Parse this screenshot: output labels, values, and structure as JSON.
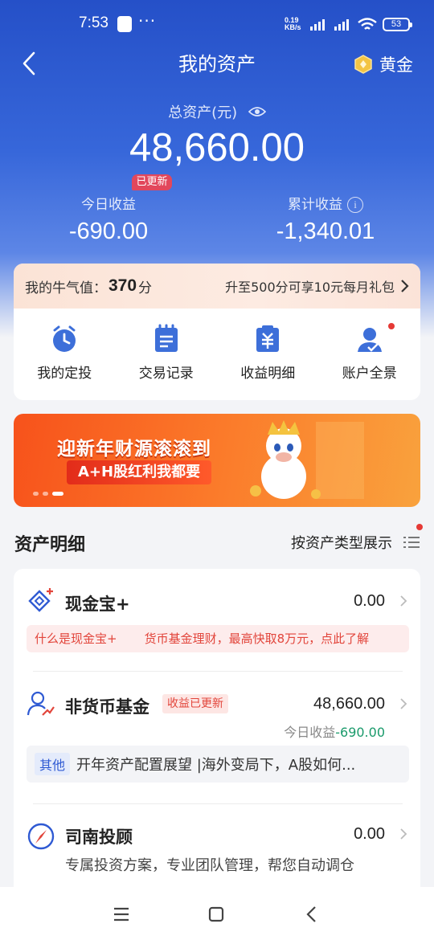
{
  "status_bar": {
    "time": "7:53",
    "more_dots": "···",
    "net_speed_value": "0.19",
    "net_speed_unit": "KB/s",
    "battery": "53"
  },
  "header": {
    "title": "我的资产",
    "gold_label": "黄金"
  },
  "summary": {
    "total_label": "总资产(元)",
    "total_value": "48,660.00",
    "updated_badge": "已更新",
    "today_label": "今日收益",
    "today_value": "-690.00",
    "cumulative_label": "累计收益",
    "cumulative_value": "-1,340.01",
    "info_glyph": "i"
  },
  "bull": {
    "label": "我的牛气值：",
    "value": "370",
    "unit": "分",
    "promo": "升至500分可享10元每月礼包"
  },
  "shortcuts": [
    {
      "label": "我的定投",
      "icon": "clock-icon"
    },
    {
      "label": "交易记录",
      "icon": "notepad-icon"
    },
    {
      "label": "收益明细",
      "icon": "yuan-doc-icon"
    },
    {
      "label": "账户全景",
      "icon": "user-card-icon",
      "has_dot": true
    }
  ],
  "banner": {
    "title": "迎新年财源滚滚到",
    "subtitle": "A+H股红利我都要"
  },
  "assets": {
    "section_title": "资产明细",
    "filter_label": "按资产类型展示",
    "items": [
      {
        "name": "现金宝+",
        "amount": "0.00",
        "marquee": [
          "什么是现金宝+",
          "货币基金理财，最高快取8万元，点此了解"
        ]
      },
      {
        "name": "非货币基金",
        "tag": "收益已更新",
        "amount": "48,660.00",
        "today_label": "今日收益",
        "today_value": "-690.00",
        "news_tag": "其他",
        "news_text": "开年资产配置展望 |海外变局下，A股如何..."
      },
      {
        "name": "司南投顾",
        "amount": "0.00",
        "desc": "专属投资方案，专业团队管理，帮您自动调仓"
      }
    ]
  },
  "colors": {
    "brand_blue": "#2f5ad3",
    "negative_green": "#1a9a6b",
    "accent_red": "#e2453b"
  }
}
